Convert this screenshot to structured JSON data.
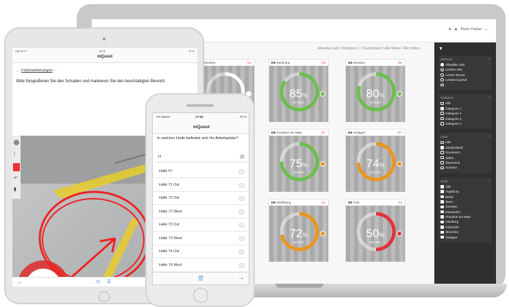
{
  "laptop": {
    "user_name": "Peter Parker",
    "breadcrumb": "Aktuelles Jahr / Kategorie 1 / Deutschland / Alle Werke / Alle Hallen",
    "cards": [
      {
        "country": "DE",
        "city": "München",
        "num": "/22",
        "percent": null,
        "color": "#ffffff",
        "label": "",
        "status": "ok",
        "row": 0,
        "col": 0
      },
      {
        "country": "DE",
        "city": "Karlsruhe",
        "num": "/08",
        "percent": 85,
        "color": "#6abf4b",
        "label": "Erreicht",
        "status": "ok",
        "row": 0,
        "col": 1
      },
      {
        "country": "DE",
        "city": "Dresden",
        "num": "/08",
        "percent": 80,
        "color": "#6abf4b",
        "label": "Erreicht",
        "status": "ok",
        "row": 0,
        "col": 2
      },
      {
        "country": "DE",
        "city": "",
        "num": "",
        "percent": null,
        "color": "#6abf4b",
        "label": "",
        "status": "ok",
        "row": 1,
        "col": 0
      },
      {
        "country": "DE",
        "city": "Frankfurt am Main",
        "num": "/07",
        "percent": 75,
        "color": "#6abf4b",
        "label": "Erreicht",
        "status": "warn",
        "row": 1,
        "col": 1
      },
      {
        "country": "DE",
        "city": "Stuttgart",
        "num": "/07",
        "percent": 74,
        "color": "#e8961e",
        "label": "Erreicht",
        "status": "ok",
        "row": 1,
        "col": 2
      },
      {
        "country": "DE",
        "city": "",
        "num": "",
        "percent": null,
        "color": "#e8961e",
        "label": "",
        "status": "ok",
        "row": 2,
        "col": 0
      },
      {
        "country": "DE",
        "city": "Wolfsburg",
        "num": "/11",
        "percent": 72,
        "color": "#e8961e",
        "label": "Erreicht",
        "status": "ok",
        "row": 2,
        "col": 1
      },
      {
        "country": "DE",
        "city": "Trier",
        "num": "/12",
        "percent": 50,
        "color": "#e0323c",
        "label": "Erreicht",
        "status": "ok",
        "row": 2,
        "col": 2
      }
    ],
    "filters": {
      "zeitraum_title": "Zeitraum",
      "zeitraum": [
        {
          "label": "Aktuelles Jahr",
          "on": true
        },
        {
          "label": "Letztes Jahr",
          "on": false
        },
        {
          "label": "Letzter Monat",
          "on": false
        },
        {
          "label": "Letztes Quartal",
          "on": false
        },
        {
          "label": "",
          "on": false
        }
      ],
      "kategorie_title": "Kategorie",
      "kategorie": [
        {
          "label": "Alle",
          "on": false
        },
        {
          "label": "Kategorie 1",
          "on": true
        },
        {
          "label": "Kategorie 2",
          "on": false
        },
        {
          "label": "Kategorie 3",
          "on": false
        },
        {
          "label": "Kategorie 4",
          "on": false
        }
      ],
      "land_title": "Land",
      "land": [
        {
          "label": "Alle",
          "on": false
        },
        {
          "label": "Deutschland",
          "on": true
        },
        {
          "label": "Frankreich",
          "on": false
        },
        {
          "label": "Italien",
          "on": false
        },
        {
          "label": "Österreich",
          "on": false
        },
        {
          "label": "Schweiz",
          "on": false
        }
      ],
      "stadt_title": "Stadt",
      "stadt": [
        {
          "label": "Alle",
          "on": true
        },
        {
          "label": "Augsburg",
          "on": true
        },
        {
          "label": "Berlin",
          "on": true
        },
        {
          "label": "Bonn",
          "on": true
        },
        {
          "label": "Dresden",
          "on": true
        },
        {
          "label": "Düsseldorf",
          "on": true
        },
        {
          "label": "Frankfurt am Main",
          "on": true
        },
        {
          "label": "Hamburg",
          "on": true
        },
        {
          "label": "Karlsruhe",
          "on": true
        },
        {
          "label": "München",
          "on": true
        },
        {
          "label": "Stuttgart",
          "on": true
        }
      ]
    }
  },
  "tablet": {
    "status_left": "Still Wi-Fi",
    "status_time": "18:05",
    "status_right": "75 %",
    "title": "mQuest",
    "back_link": "Fotomarkierungen",
    "instruction": "Bitte fotografieren Sie den Schaden und markieren Sie den beschädigten Bereich:"
  },
  "phone": {
    "carrier": "Carrier",
    "time": "17:53",
    "battery": "76 %",
    "title": "mQuest",
    "question": "In welcher Halle befindet sich Ihr Arbeitsplatz?",
    "search_value": "H",
    "options": [
      "Halle 67",
      "Halle 71 Ost",
      "Halle 72 Ost",
      "Halle 72 West",
      "Halle 73 Ost",
      "Halle 73 West",
      "Halle 74 Ost",
      "Halle 74 West"
    ]
  },
  "colors": {
    "accent": "#2a7de1",
    "green": "#6abf4b",
    "orange": "#e8961e",
    "red": "#e0323c",
    "panel": "#2f2f2f"
  }
}
